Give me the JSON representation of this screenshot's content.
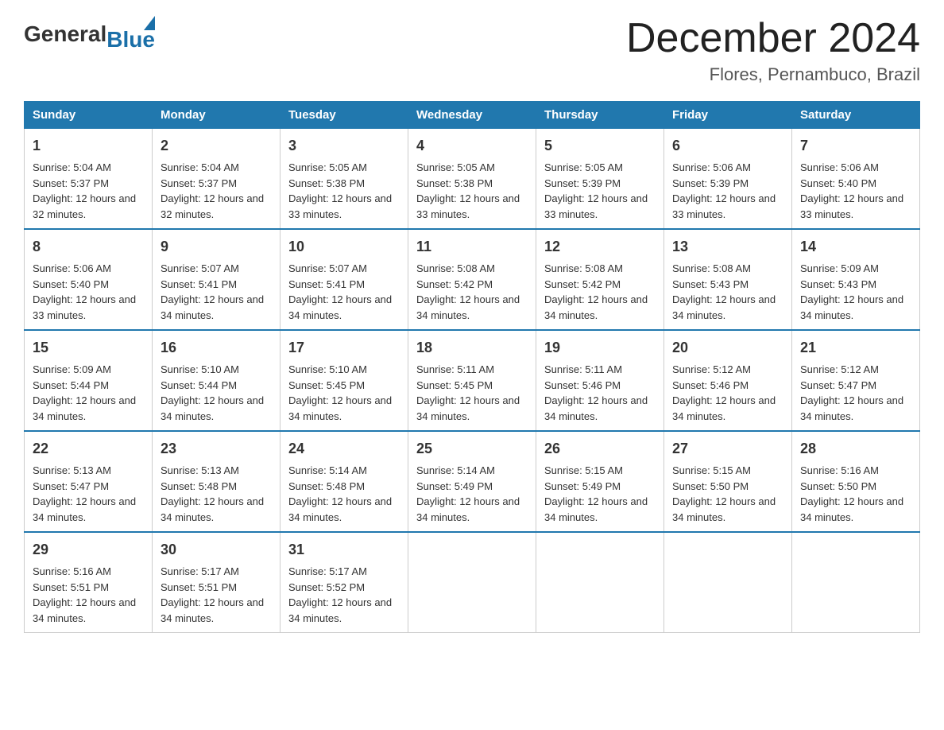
{
  "header": {
    "logo": {
      "general": "General",
      "blue": "Blue"
    },
    "title": "December 2024",
    "location": "Flores, Pernambuco, Brazil"
  },
  "columns": [
    "Sunday",
    "Monday",
    "Tuesday",
    "Wednesday",
    "Thursday",
    "Friday",
    "Saturday"
  ],
  "weeks": [
    [
      {
        "day": "1",
        "sunrise": "5:04 AM",
        "sunset": "5:37 PM",
        "daylight": "12 hours and 32 minutes."
      },
      {
        "day": "2",
        "sunrise": "5:04 AM",
        "sunset": "5:37 PM",
        "daylight": "12 hours and 32 minutes."
      },
      {
        "day": "3",
        "sunrise": "5:05 AM",
        "sunset": "5:38 PM",
        "daylight": "12 hours and 33 minutes."
      },
      {
        "day": "4",
        "sunrise": "5:05 AM",
        "sunset": "5:38 PM",
        "daylight": "12 hours and 33 minutes."
      },
      {
        "day": "5",
        "sunrise": "5:05 AM",
        "sunset": "5:39 PM",
        "daylight": "12 hours and 33 minutes."
      },
      {
        "day": "6",
        "sunrise": "5:06 AM",
        "sunset": "5:39 PM",
        "daylight": "12 hours and 33 minutes."
      },
      {
        "day": "7",
        "sunrise": "5:06 AM",
        "sunset": "5:40 PM",
        "daylight": "12 hours and 33 minutes."
      }
    ],
    [
      {
        "day": "8",
        "sunrise": "5:06 AM",
        "sunset": "5:40 PM",
        "daylight": "12 hours and 33 minutes."
      },
      {
        "day": "9",
        "sunrise": "5:07 AM",
        "sunset": "5:41 PM",
        "daylight": "12 hours and 34 minutes."
      },
      {
        "day": "10",
        "sunrise": "5:07 AM",
        "sunset": "5:41 PM",
        "daylight": "12 hours and 34 minutes."
      },
      {
        "day": "11",
        "sunrise": "5:08 AM",
        "sunset": "5:42 PM",
        "daylight": "12 hours and 34 minutes."
      },
      {
        "day": "12",
        "sunrise": "5:08 AM",
        "sunset": "5:42 PM",
        "daylight": "12 hours and 34 minutes."
      },
      {
        "day": "13",
        "sunrise": "5:08 AM",
        "sunset": "5:43 PM",
        "daylight": "12 hours and 34 minutes."
      },
      {
        "day": "14",
        "sunrise": "5:09 AM",
        "sunset": "5:43 PM",
        "daylight": "12 hours and 34 minutes."
      }
    ],
    [
      {
        "day": "15",
        "sunrise": "5:09 AM",
        "sunset": "5:44 PM",
        "daylight": "12 hours and 34 minutes."
      },
      {
        "day": "16",
        "sunrise": "5:10 AM",
        "sunset": "5:44 PM",
        "daylight": "12 hours and 34 minutes."
      },
      {
        "day": "17",
        "sunrise": "5:10 AM",
        "sunset": "5:45 PM",
        "daylight": "12 hours and 34 minutes."
      },
      {
        "day": "18",
        "sunrise": "5:11 AM",
        "sunset": "5:45 PM",
        "daylight": "12 hours and 34 minutes."
      },
      {
        "day": "19",
        "sunrise": "5:11 AM",
        "sunset": "5:46 PM",
        "daylight": "12 hours and 34 minutes."
      },
      {
        "day": "20",
        "sunrise": "5:12 AM",
        "sunset": "5:46 PM",
        "daylight": "12 hours and 34 minutes."
      },
      {
        "day": "21",
        "sunrise": "5:12 AM",
        "sunset": "5:47 PM",
        "daylight": "12 hours and 34 minutes."
      }
    ],
    [
      {
        "day": "22",
        "sunrise": "5:13 AM",
        "sunset": "5:47 PM",
        "daylight": "12 hours and 34 minutes."
      },
      {
        "day": "23",
        "sunrise": "5:13 AM",
        "sunset": "5:48 PM",
        "daylight": "12 hours and 34 minutes."
      },
      {
        "day": "24",
        "sunrise": "5:14 AM",
        "sunset": "5:48 PM",
        "daylight": "12 hours and 34 minutes."
      },
      {
        "day": "25",
        "sunrise": "5:14 AM",
        "sunset": "5:49 PM",
        "daylight": "12 hours and 34 minutes."
      },
      {
        "day": "26",
        "sunrise": "5:15 AM",
        "sunset": "5:49 PM",
        "daylight": "12 hours and 34 minutes."
      },
      {
        "day": "27",
        "sunrise": "5:15 AM",
        "sunset": "5:50 PM",
        "daylight": "12 hours and 34 minutes."
      },
      {
        "day": "28",
        "sunrise": "5:16 AM",
        "sunset": "5:50 PM",
        "daylight": "12 hours and 34 minutes."
      }
    ],
    [
      {
        "day": "29",
        "sunrise": "5:16 AM",
        "sunset": "5:51 PM",
        "daylight": "12 hours and 34 minutes."
      },
      {
        "day": "30",
        "sunrise": "5:17 AM",
        "sunset": "5:51 PM",
        "daylight": "12 hours and 34 minutes."
      },
      {
        "day": "31",
        "sunrise": "5:17 AM",
        "sunset": "5:52 PM",
        "daylight": "12 hours and 34 minutes."
      },
      null,
      null,
      null,
      null
    ]
  ]
}
